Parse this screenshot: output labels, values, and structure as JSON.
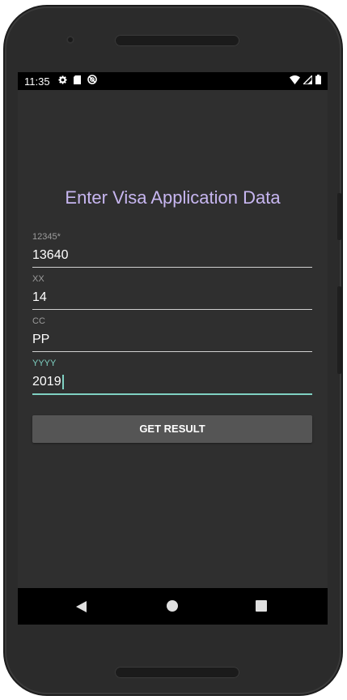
{
  "status_bar": {
    "time": "11:35",
    "left_icons": [
      "gear-icon",
      "sd-card-icon",
      "no-disturb-icon"
    ],
    "right_icons": [
      "wifi-icon",
      "cell-signal-icon",
      "battery-icon"
    ]
  },
  "app": {
    "title": "Enter Visa Application Data"
  },
  "form": {
    "fields": [
      {
        "label": "12345*",
        "value": "13640"
      },
      {
        "label": "XX",
        "value": "14"
      },
      {
        "label": "CC",
        "value": "PP"
      },
      {
        "label": "YYYY",
        "value": "2019"
      }
    ],
    "submit_label": "GET RESULT"
  },
  "colors": {
    "title": "#c7b6f0",
    "accent": "#7fd0c2",
    "background": "#2f2f2f",
    "button": "#555555"
  }
}
